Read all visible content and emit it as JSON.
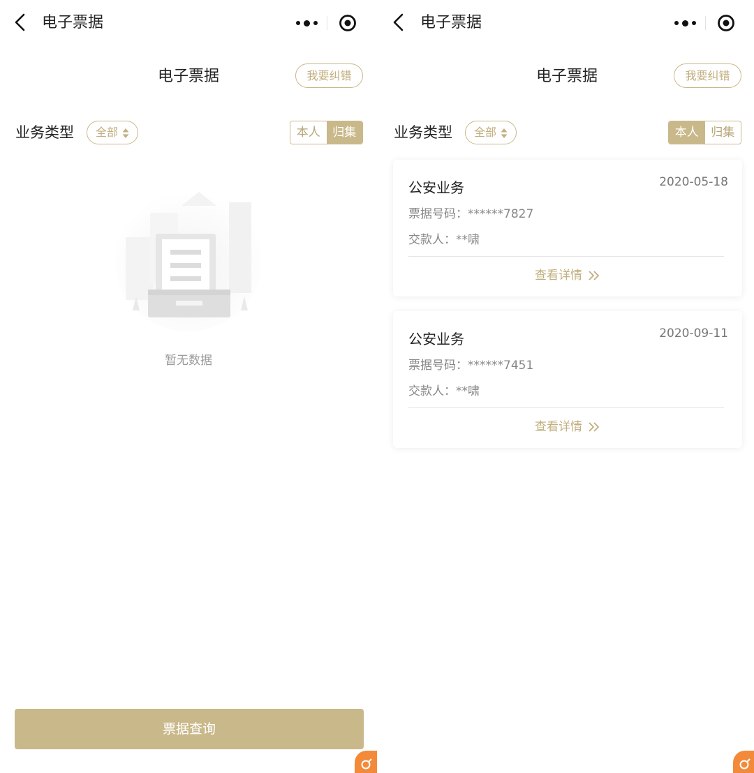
{
  "colors": {
    "accent": "#c9b88a",
    "accent_text": "#c2ae7e",
    "badge": "#f28a3a"
  },
  "left": {
    "nav": {
      "title": "电子票据"
    },
    "header": {
      "title": "电子票据",
      "correct_button": "我要纠错"
    },
    "filter": {
      "label": "业务类型",
      "select_value": "全部",
      "toggle": [
        "本人",
        "归集"
      ],
      "active": "归集"
    },
    "empty": {
      "text": "暂无数据",
      "icon": "document-tray-icon"
    },
    "query_button": "票据查询"
  },
  "right": {
    "nav": {
      "title": "电子票据"
    },
    "header": {
      "title": "电子票据",
      "correct_button": "我要纠错"
    },
    "filter": {
      "label": "业务类型",
      "select_value": "全部",
      "toggle": [
        "本人",
        "归集"
      ],
      "active": "本人"
    },
    "cards": [
      {
        "business": "公安业务",
        "date": "2020-05-18",
        "ticket_label": "票据号码：",
        "ticket_no": "******7827",
        "payer_label": "交款人：",
        "payer": "**啸",
        "detail": "查看详情"
      },
      {
        "business": "公安业务",
        "date": "2020-09-11",
        "ticket_label": "票据号码：",
        "ticket_no": "******7451",
        "payer_label": "交款人：",
        "payer": "**啸",
        "detail": "查看详情"
      }
    ]
  }
}
